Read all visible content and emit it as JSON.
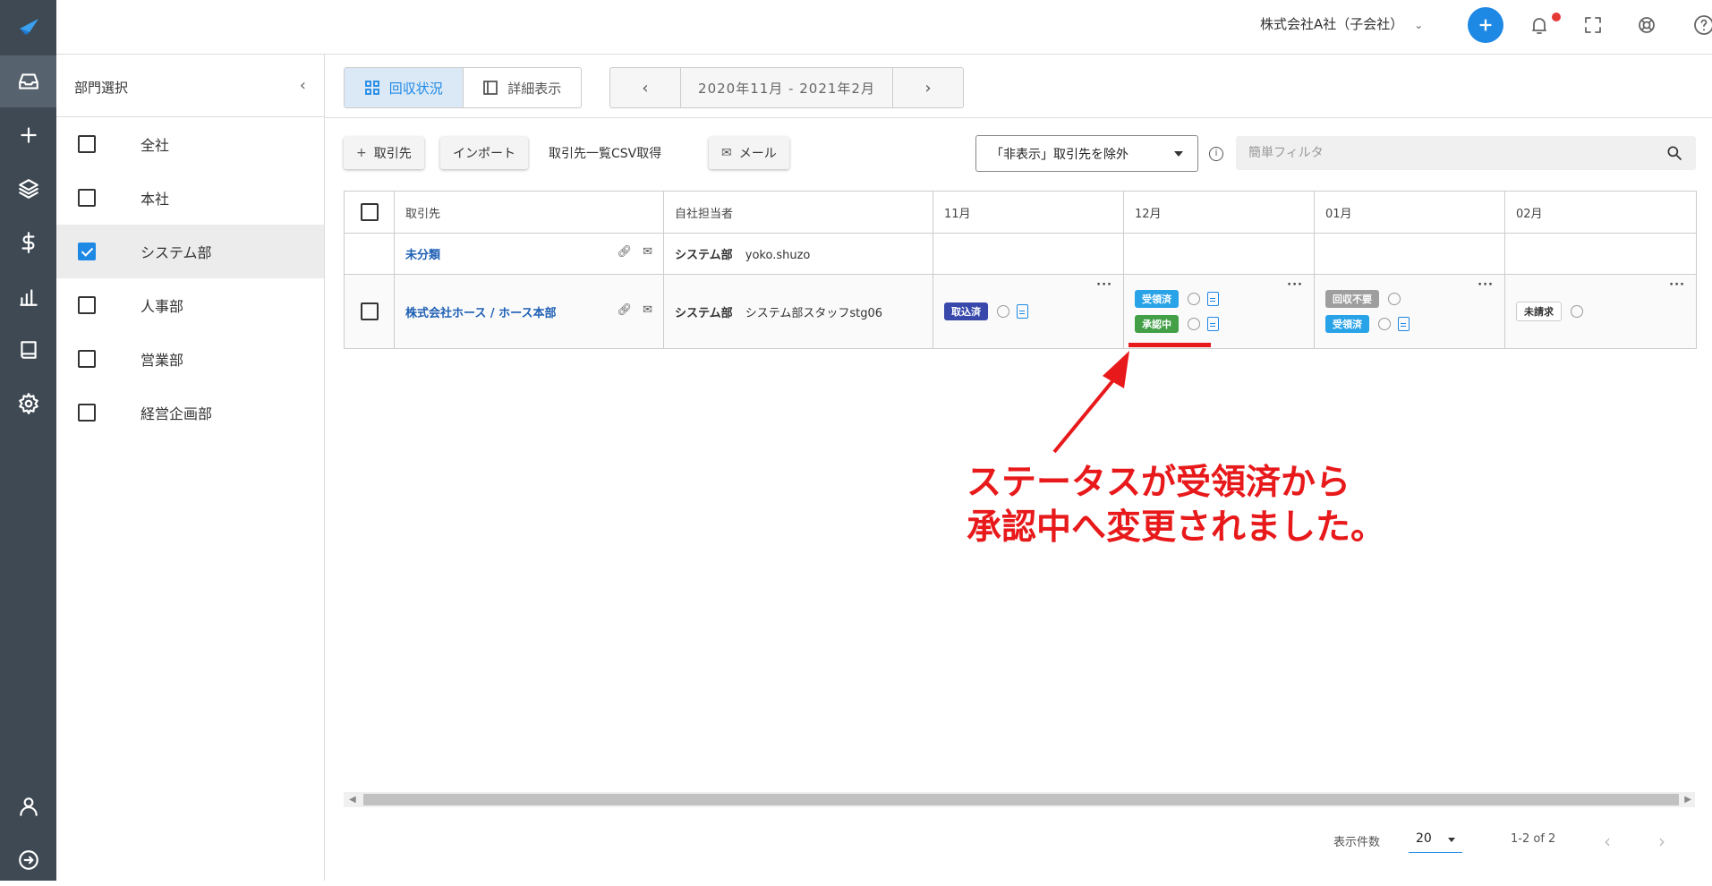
{
  "topbar": {
    "company": "株式会社A社（子会社）"
  },
  "dept_panel": {
    "title": "部門選択",
    "items": [
      {
        "label": "全社",
        "checked": false
      },
      {
        "label": "本社",
        "checked": false
      },
      {
        "label": "システム部",
        "checked": true
      },
      {
        "label": "人事部",
        "checked": false
      },
      {
        "label": "営業部",
        "checked": false
      },
      {
        "label": "経営企画部",
        "checked": false
      }
    ]
  },
  "view": {
    "status_label": "回収状況",
    "detail_label": "詳細表示",
    "period": "2020年11月 - 2021年2月"
  },
  "toolbar": {
    "add_vendor": "取引先",
    "import": "インポート",
    "csv": "取引先一覧CSV取得",
    "mail": "メール",
    "filter_value": "「非表示」取引先を除外",
    "search_placeholder": "簡単フィルタ"
  },
  "table": {
    "headers": [
      "取引先",
      "自社担当者",
      "11月",
      "12月",
      "01月",
      "02月"
    ],
    "rows": [
      {
        "vendor": "未分類",
        "dept": "システム部",
        "person": "yoko.shuzo"
      },
      {
        "vendor": "株式会社ホース / ホース本部",
        "dept": "システム部",
        "person": "システム部スタッフstg06",
        "nov": [
          "取込済"
        ],
        "dec": [
          "受領済",
          "承認中"
        ],
        "jan": [
          "回収不要",
          "受領済"
        ],
        "feb": [
          "未請求"
        ]
      }
    ]
  },
  "annotation": {
    "line1": "ステータスが受領済から",
    "line2": "承認中へ変更されました。",
    "color": "#e8191b"
  },
  "pagination": {
    "per_page_label": "表示件数",
    "per_page": "20",
    "range": "1-2 of 2"
  },
  "colors": {
    "rail": "#3e4954",
    "accent": "#1e88e5"
  }
}
